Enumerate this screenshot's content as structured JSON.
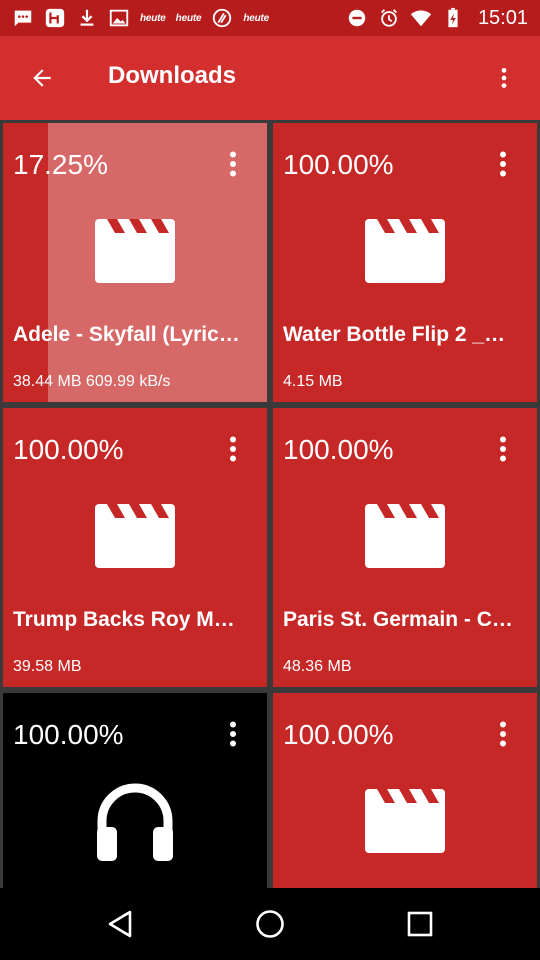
{
  "status_bar": {
    "time": "15:01",
    "heute_labels": [
      "heute",
      "heute",
      "heute"
    ],
    "left_icons": [
      "chat-bubble-icon",
      "heute-app-icon",
      "download-icon",
      "image-icon",
      "heute-label",
      "heute-label",
      "zdf-icon",
      "heute-label"
    ],
    "right_icons": [
      "do-not-disturb-icon",
      "alarm-icon",
      "wifi-icon",
      "battery-icon"
    ]
  },
  "app_bar": {
    "title": "Downloads",
    "back_icon": "arrow-back-icon",
    "more_icon": "more-vert-icon"
  },
  "colors": {
    "status_bar": "#b71c1c",
    "app_bar": "#d32f2f",
    "card": "#c62828",
    "card_dark": "#000000",
    "grid_background": "#3a3a3a"
  },
  "downloads": [
    {
      "percent": "17.25%",
      "progress": 0.1725,
      "name": "Adele - Skyfall (Lyric…",
      "info": "38.44 MB 609.99 kB/s",
      "type": "video",
      "icon": "video-clapper-icon"
    },
    {
      "percent": "100.00%",
      "progress": 1.0,
      "name": "Water Bottle Flip 2 _…",
      "info": "4.15 MB",
      "type": "video",
      "icon": "video-clapper-icon"
    },
    {
      "percent": "100.00%",
      "progress": 1.0,
      "name": "Trump Backs Roy M…",
      "info": "39.58 MB",
      "type": "video",
      "icon": "video-clapper-icon"
    },
    {
      "percent": "100.00%",
      "progress": 1.0,
      "name": "Paris St. Germain - C…",
      "info": "48.36 MB",
      "type": "video",
      "icon": "video-clapper-icon"
    },
    {
      "percent": "100.00%",
      "progress": 1.0,
      "name": "",
      "info": "",
      "type": "audio",
      "icon": "headphones-icon"
    },
    {
      "percent": "100.00%",
      "progress": 1.0,
      "name": "",
      "info": "",
      "type": "video",
      "icon": "video-clapper-icon"
    }
  ],
  "nav_bar": {
    "back_icon": "nav-back-icon",
    "home_icon": "nav-home-icon",
    "recents_icon": "nav-recents-icon"
  }
}
